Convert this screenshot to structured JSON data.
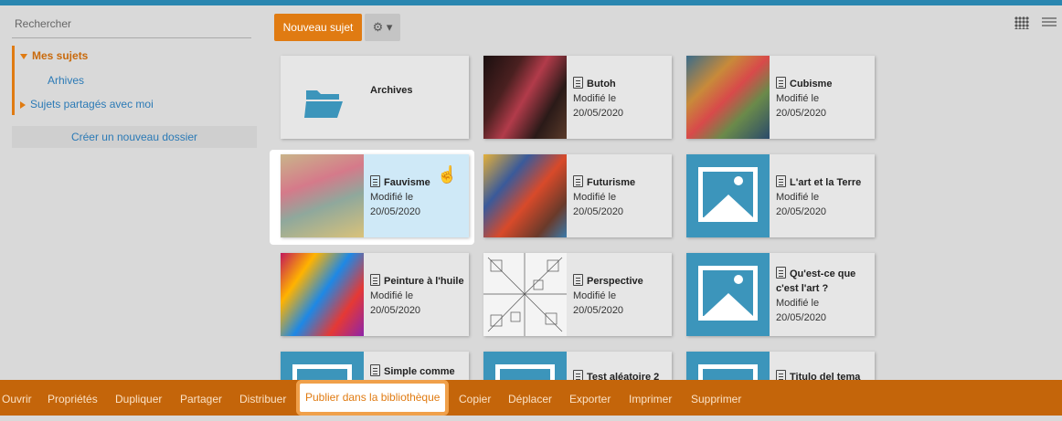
{
  "sidebar": {
    "search_placeholder": "Rechercher",
    "tree": {
      "mine": "Mes sujets",
      "archives": "Arhives",
      "shared": "Sujets partagés avec moi"
    },
    "new_folder": "Créer un nouveau dossier"
  },
  "toolbar": {
    "new_subject": "Nouveau sujet",
    "gear": "⚙ ▾"
  },
  "cards": {
    "archives": {
      "title": "Archives"
    },
    "butoh": {
      "title": "Butoh",
      "modified": "Modifié le",
      "date": "20/05/2020"
    },
    "cubisme": {
      "title": "Cubisme",
      "modified": "Modifié le",
      "date": "20/05/2020"
    },
    "fauvisme": {
      "title": "Fauvisme",
      "modified": "Modifié le",
      "date": "20/05/2020"
    },
    "futurisme": {
      "title": "Futurisme",
      "modified": "Modifié le",
      "date": "20/05/2020"
    },
    "art_terre": {
      "title": "L'art et la Terre",
      "modified": "Modifié le",
      "date": "20/05/2020"
    },
    "peinture": {
      "title": "Peinture à l'huile",
      "modified": "Modifié le",
      "date": "20/05/2020"
    },
    "perspective": {
      "title": "Perspective",
      "modified": "Modifié le",
      "date": "20/05/2020"
    },
    "quest_art": {
      "title": "Qu'est-ce que c'est l'art ?",
      "modified": "Modifié le",
      "date": "20/05/2020"
    },
    "simple": {
      "title": "Simple comme"
    },
    "test": {
      "title": "Test aléatoire 2"
    },
    "titulo": {
      "title": "Titulo del tema"
    }
  },
  "actions": {
    "open": "Ouvrir",
    "properties": "Propriétés",
    "duplicate": "Dupliquer",
    "share": "Partager",
    "distribute": "Distribuer",
    "publish": "Publier dans la bibliothèque",
    "copy": "Copier",
    "move": "Déplacer",
    "export": "Exporter",
    "print": "Imprimer",
    "delete": "Supprimer"
  },
  "colors": {
    "accent": "#e07b12",
    "action_bar": "#c4650a",
    "link": "#2b7ab6",
    "placeholder_bg": "#3c95bb",
    "selected_bg": "#cfe9f7"
  }
}
